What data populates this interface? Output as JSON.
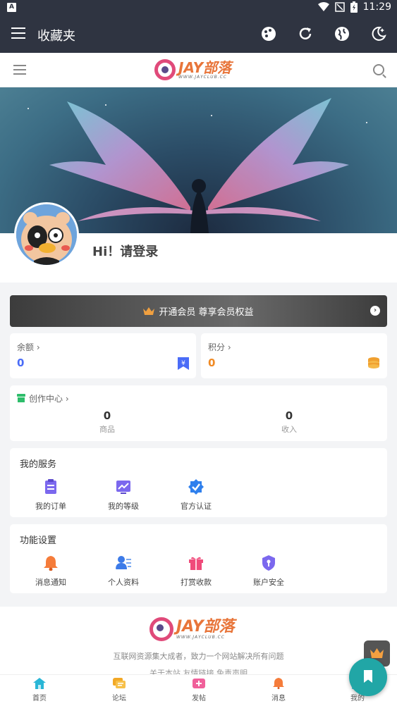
{
  "statusbar": {
    "time": "11:29"
  },
  "appbar": {
    "title": "收藏夹"
  },
  "site": {
    "logo_text": "JAY部落",
    "logo_sub": "WWW.JAYCLUB.CC"
  },
  "profile": {
    "greeting": "Hi！请登录"
  },
  "vip": {
    "label": "开通会员 尊享会员权益"
  },
  "wallet": {
    "balance": {
      "label": "余额 ›",
      "value": "0",
      "color": "#4a6cf7"
    },
    "points": {
      "label": "积分 ›",
      "value": "0",
      "color": "#f08a24"
    }
  },
  "creator": {
    "title": "创作中心 ›",
    "stats": [
      {
        "value": "0",
        "label": "商品"
      },
      {
        "value": "0",
        "label": "收入"
      }
    ]
  },
  "services": {
    "title": "我的服务",
    "items": [
      {
        "label": "我的订单",
        "icon": "clipboard-icon",
        "color": "#7b68ee"
      },
      {
        "label": "我的等级",
        "icon": "chart-icon",
        "color": "#7b68ee"
      },
      {
        "label": "官方认证",
        "icon": "verified-icon",
        "color": "#2f80ed"
      }
    ]
  },
  "settings": {
    "title": "功能设置",
    "items": [
      {
        "label": "消息通知",
        "icon": "bell-icon",
        "color": "#f57c3a"
      },
      {
        "label": "个人资料",
        "icon": "profile-icon",
        "color": "#3d7be8"
      },
      {
        "label": "打赏收款",
        "icon": "gift-icon",
        "color": "#f04a7a"
      },
      {
        "label": "账户安全",
        "icon": "shield-icon",
        "color": "#7b68ee"
      }
    ]
  },
  "footer": {
    "desc": "互联网资源集大成者，致力一个网站解决所有问题",
    "links": "关于本站   友情链接   免责声明"
  },
  "tabs": [
    {
      "label": "首页",
      "icon": "home-icon",
      "color": "#29b6d6"
    },
    {
      "label": "论坛",
      "icon": "forum-icon",
      "color": "#f2a825"
    },
    {
      "label": "发帖",
      "icon": "post-icon",
      "color": "#f0609a"
    },
    {
      "label": "消息",
      "icon": "bell-icon",
      "color": "#f57c3a"
    },
    {
      "label": "我的",
      "icon": "user-icon",
      "color": "#29b6d6"
    }
  ]
}
